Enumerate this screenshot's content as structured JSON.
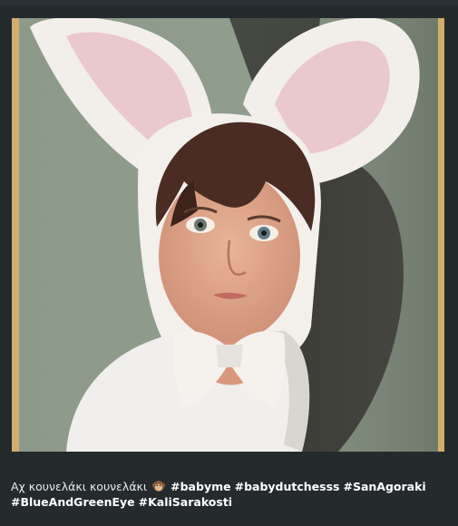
{
  "photo": {
    "alt_icon": "easter-bunny-child-photo"
  },
  "caption": {
    "text": "Αχ κουνελάκι κουνελάκι",
    "emoji_icon": "monkey-face-icon",
    "hashtags": [
      "#babyme",
      "#babydutchesss",
      "#SanAgoraki",
      "#BlueAndGreenEye",
      "#KaliSarakosti"
    ]
  }
}
